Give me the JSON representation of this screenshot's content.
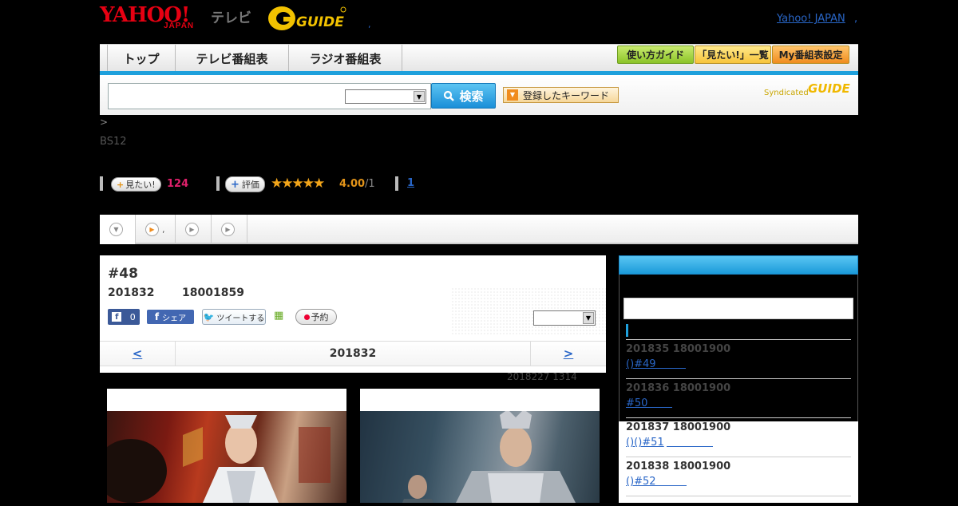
{
  "header": {
    "logo_yahoo": "YAHOO!",
    "logo_japan": "JAPAN",
    "logo_tv": "テレビ",
    "logo_gguide": "GUIDE",
    "dot_text": ",",
    "yahoo_japan_link": "Yahoo! JAPAN",
    "yahoo_japan_sep": ","
  },
  "nav": {
    "tabs": [
      "トップ",
      "テレビ番組表",
      "ラジオ番組表"
    ],
    "guide_buttons": [
      "使い方ガイド",
      "「見たい!」一覧",
      "My番組表設定"
    ]
  },
  "search": {
    "input_value": "",
    "select_value": "",
    "button_label": "検索",
    "keyword_button": "登録したキーワード",
    "syndicated": "Syndicated",
    "syndicated_brand": "GUIDE"
  },
  "breadcrumb": ">",
  "channel": "BS12",
  "stats": {
    "watch_button": "見たい!",
    "watch_count": "124",
    "rate_button": "評価",
    "stars": "★★★★★",
    "score": "4.00",
    "score_count": "/1",
    "review_link": "1"
  },
  "program_tabs": [
    "",
    ",",
    "",
    ""
  ],
  "program": {
    "episode": "#48",
    "date": "201832",
    "time": "18001859",
    "fb_like_count": "0",
    "fb_share": "シェア",
    "tweet": "ツイートする",
    "reserve": "予約",
    "select_value": "",
    "pager_prev": "<",
    "pager_date": "201832",
    "pager_next": ">",
    "updated": "2018227  1314"
  },
  "sidebar": {
    "episodes": [
      {
        "date": "201835  18001900",
        "link": "()#49"
      },
      {
        "date": "201836  18001900",
        "link": "#50"
      },
      {
        "date": "201837  18001900",
        "link": "()()#51"
      },
      {
        "date": "201838  18001900",
        "link": "()#52"
      }
    ]
  },
  "colors": {
    "accent_blue": "#1ea0dc",
    "link": "#2966c7",
    "watch_pink": "#e0206b",
    "score_orange": "#e39419"
  }
}
